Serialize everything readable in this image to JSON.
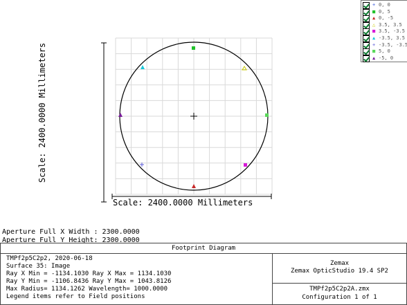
{
  "plot": {
    "vertical_label": "Scale: 2400.0000 Millimeters",
    "horizontal_label": "Scale: 2400.0000 Millimeters"
  },
  "legend": {
    "items": [
      {
        "label": "0, 0",
        "symbol": "+",
        "color": "#3b5bdb"
      },
      {
        "label": "0, 5",
        "symbol": "■",
        "color": "#22c22c"
      },
      {
        "label": "0, -5",
        "symbol": "▲",
        "color": "#c62828"
      },
      {
        "label": "3.5, 3.5",
        "symbol": "△",
        "color": "#c9c900"
      },
      {
        "label": "3.5, -3.5",
        "symbol": "■",
        "color": "#d81ad8"
      },
      {
        "label": "-3.5, 3.5",
        "symbol": "▲",
        "color": "#19c6d8"
      },
      {
        "label": "-3.5, -3.5",
        "symbol": "+",
        "color": "#5b5bd8"
      },
      {
        "label": "5, 0",
        "symbol": "■",
        "color": "#5ad85a"
      },
      {
        "label": "-5, 0",
        "symbol": "▲",
        "color": "#7a1a9a"
      }
    ]
  },
  "aperture": {
    "x_width": "Aperture Full X Width : 2300.0000",
    "y_height": "Aperture Full Y Height: 2300.0000"
  },
  "footer": {
    "title": "Footprint Diagram",
    "left_lines": [
      "TMPf2p5C2p2, 2020-06-18",
      "Surface 35: Image",
      "Ray X Min = -1134.1030 Ray X Max = 1134.1030",
      "Ray Y Min = -1106.8436 Ray Y Max = 1043.8126",
      "Max Radius= 1134.1262 Wavelength= 1000.0000",
      "Legend items refer to Field positions"
    ],
    "right_top_lines": [
      "Zemax",
      "Zemax OpticStudio 19.4 SP2"
    ],
    "right_bottom_lines": [
      "TMPf2p5C2p2A.zmx",
      "Configuration 1 of 1"
    ]
  }
}
